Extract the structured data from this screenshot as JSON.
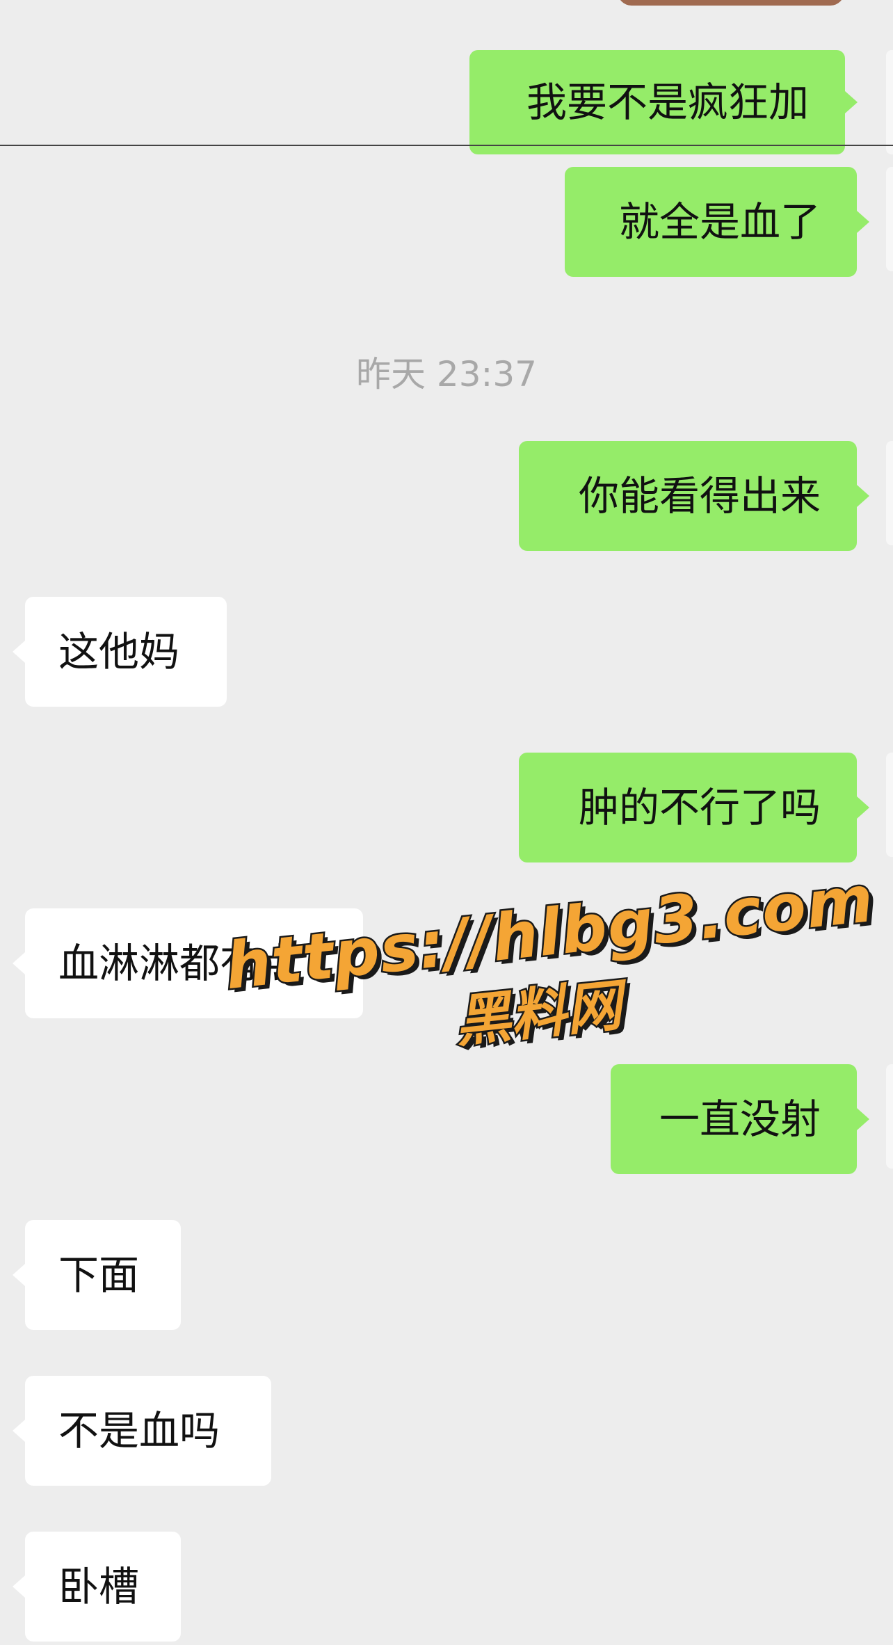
{
  "messages": [
    {
      "side": "sent",
      "text": "我要不是疯狂加"
    },
    {
      "side": "sent",
      "text": "就全是血了"
    },
    {
      "side": "sent",
      "text": "你能看得出来"
    },
    {
      "side": "recv",
      "text": "这他妈"
    },
    {
      "side": "sent",
      "text": "肿的不行了吗"
    },
    {
      "side": "recv",
      "text": "血淋淋都有点"
    },
    {
      "side": "sent",
      "text": "一直没射"
    },
    {
      "side": "recv",
      "text": "下面"
    },
    {
      "side": "recv",
      "text": "不是血吗"
    },
    {
      "side": "recv",
      "text": "卧槽"
    }
  ],
  "timestamp": "昨天 23:37",
  "watermark": {
    "line1": "https://hlbg3.com",
    "line2": "黑料网"
  },
  "colors": {
    "background": "#ededed",
    "sent_bubble": "#95ec69",
    "recv_bubble": "#ffffff",
    "timestamp_text": "#a8a8a8",
    "watermark_fill": "#f4a535"
  }
}
